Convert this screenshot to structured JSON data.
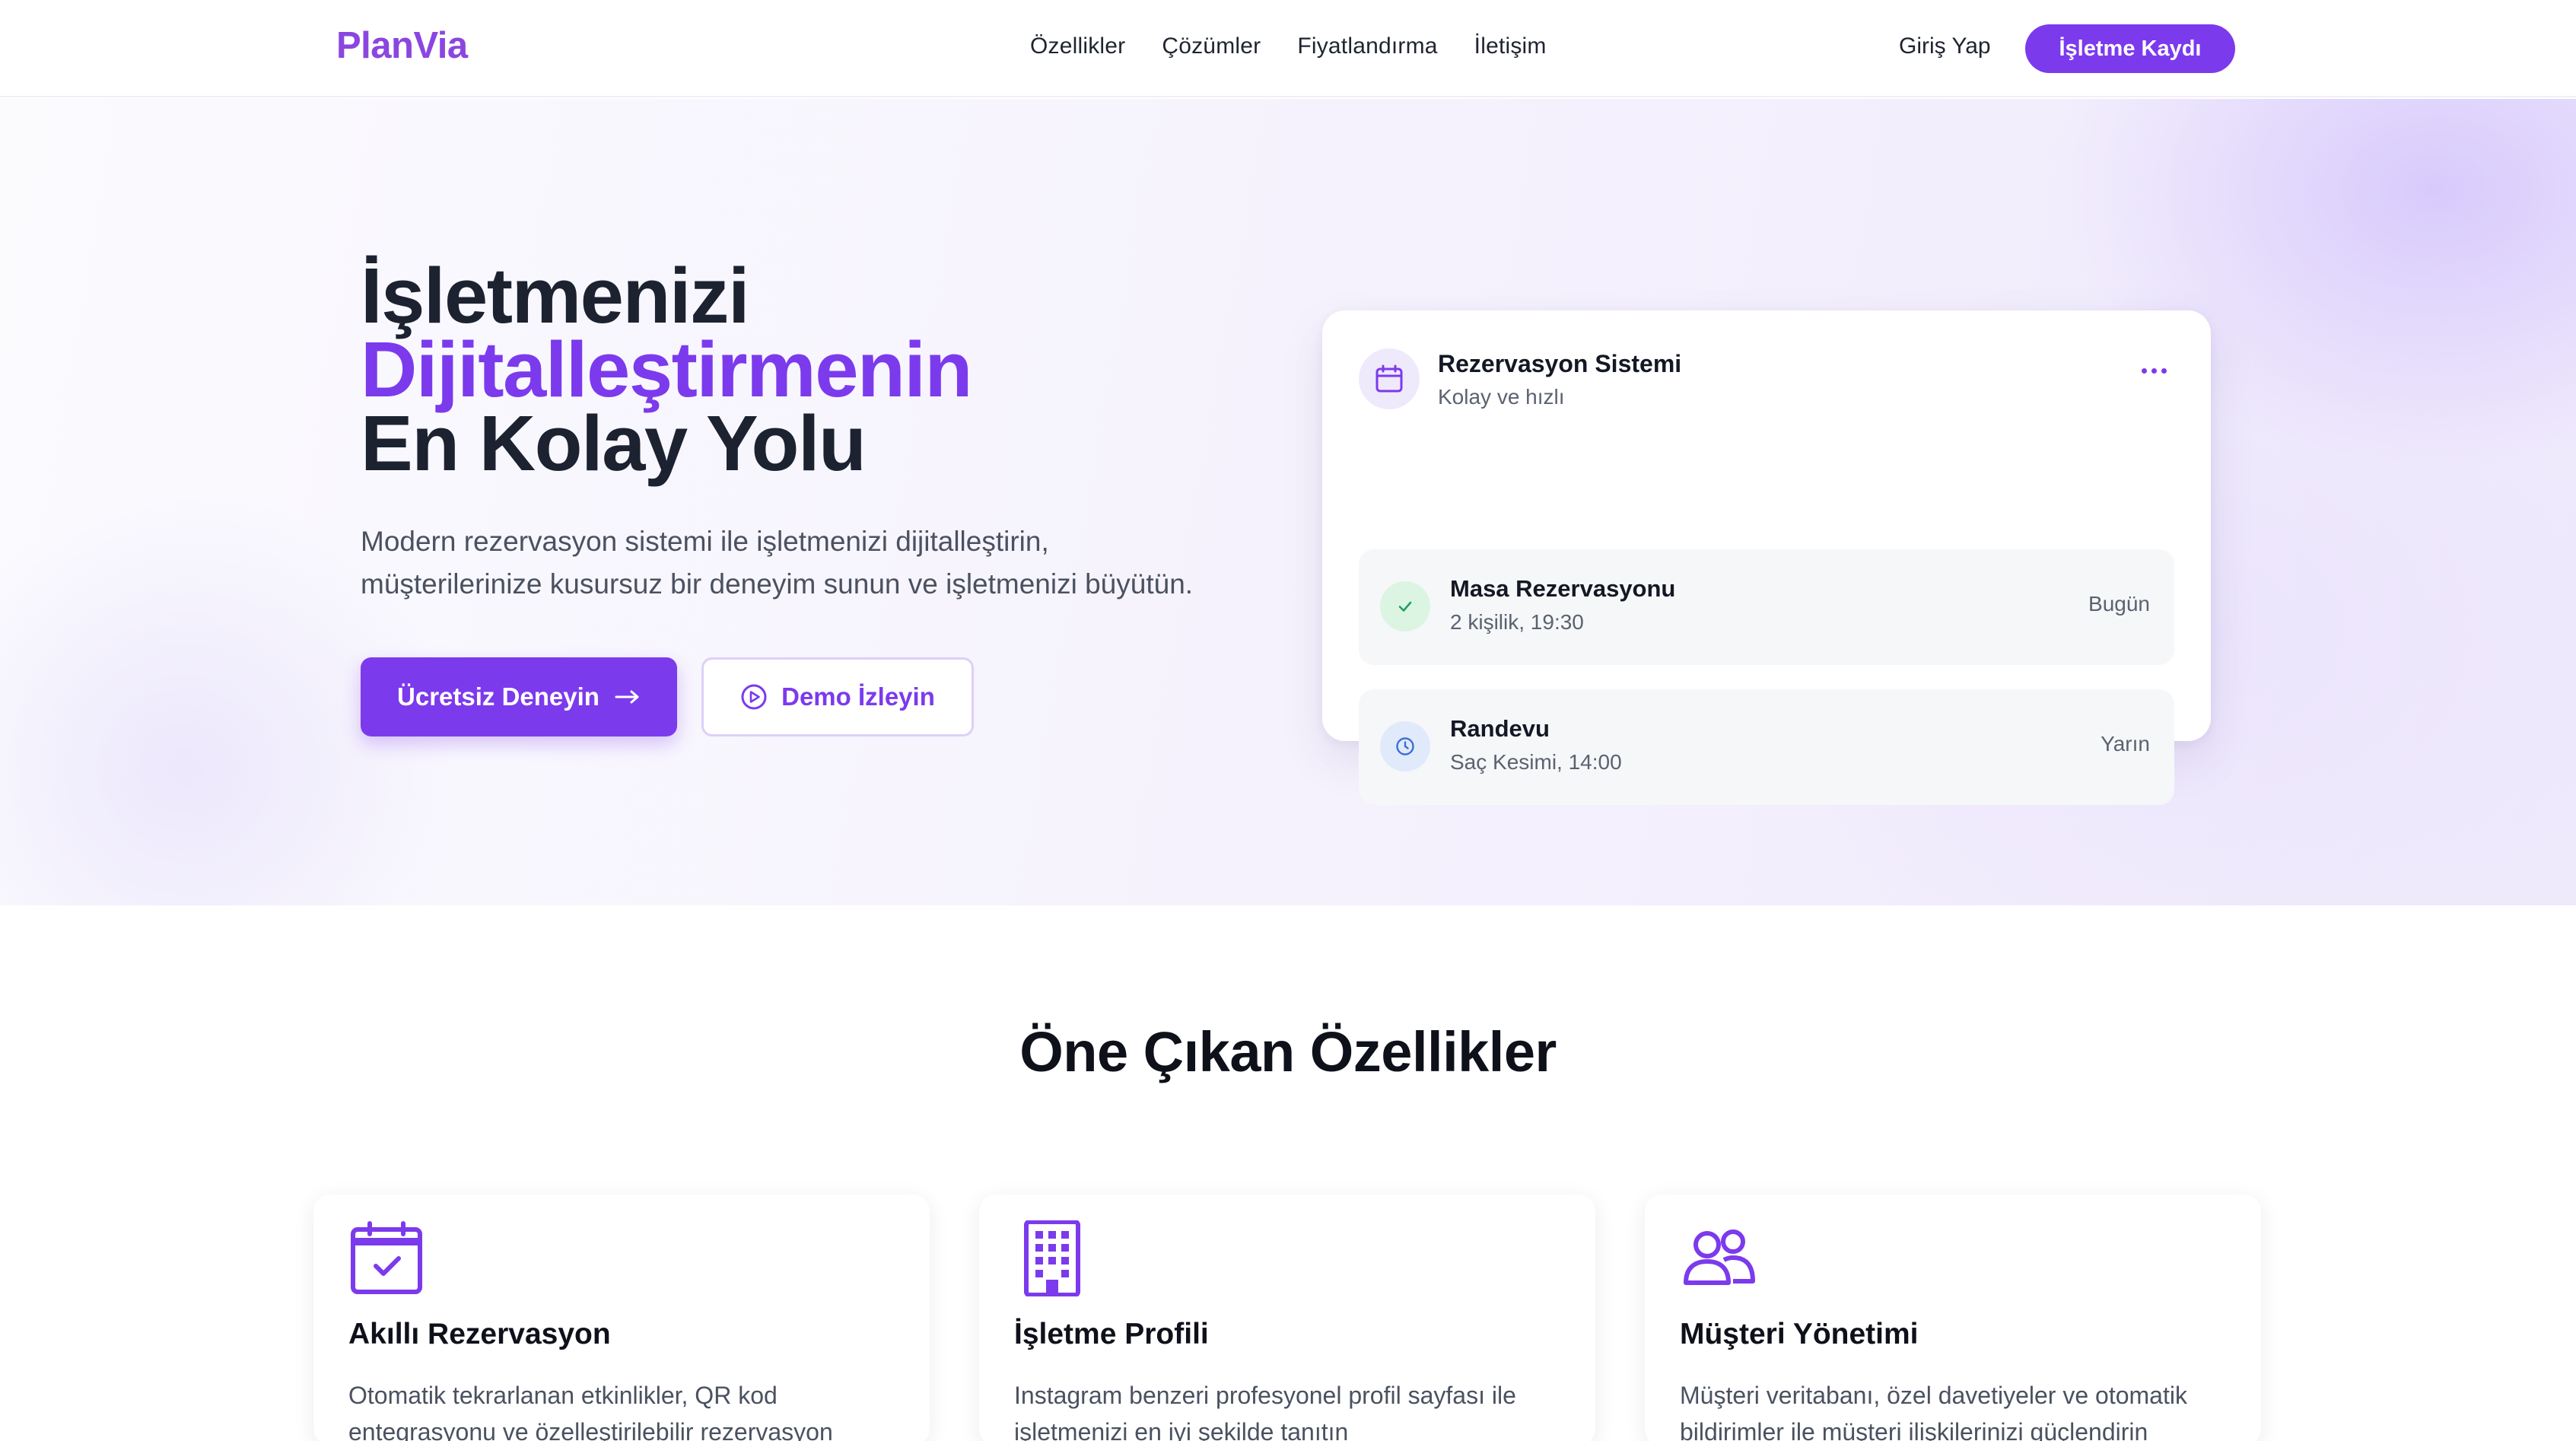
{
  "header": {
    "logo": "PlanVia",
    "nav": [
      "Özellikler",
      "Çözümler",
      "Fiyatlandırma",
      "İletişim"
    ],
    "login": "Giriş Yap",
    "register": "İşletme Kaydı"
  },
  "hero": {
    "title_line1": "İşletmenizi",
    "title_line2": "Dijitalleştirmenin",
    "title_line3": "En Kolay Yolu",
    "subtitle_line1": "Modern rezervasyon sistemi ile işletmenizi dijitalleştirin,",
    "subtitle_line2": "müşterilerinize kusursuz bir deneyim sunun ve işletmenizi büyütün.",
    "primary_button": "Ücretsiz Deneyin",
    "secondary_button": "Demo İzleyin"
  },
  "reservation_card": {
    "title": "Rezervasyon Sistemi",
    "subtitle": "Kolay ve hızlı",
    "items": [
      {
        "name": "Masa Rezervasyonu",
        "detail": "2 kişilik, 19:30",
        "when": "Bugün",
        "status": "confirmed"
      },
      {
        "name": "Randevu",
        "detail": "Saç Kesimi, 14:00",
        "when": "Yarın",
        "status": "pending"
      }
    ]
  },
  "features": {
    "title": "Öne Çıkan Özellikler",
    "cards": [
      {
        "icon": "calendar-check-icon",
        "name": "Akıllı Rezervasyon",
        "desc": "Otomatik tekrarlanan etkinlikler, QR kod entegrasyonu ve özelleştirilebilir rezervasyon"
      },
      {
        "icon": "building-icon",
        "name": "İşletme Profili",
        "desc": "Instagram benzeri profesyonel profil sayfası ile işletmenizi en iyi şekilde tanıtın"
      },
      {
        "icon": "users-icon",
        "name": "Müşteri Yönetimi",
        "desc": "Müşteri veritabanı, özel davetiyeler ve otomatik bildirimler ile müşteri ilişkilerinizi güçlendirin"
      }
    ]
  },
  "colors": {
    "accent": "#7c3aed",
    "logo": "#8b46e0",
    "text": "#1c2230",
    "success_bg": "#dcf5e3",
    "info_bg": "#e0eafb"
  }
}
